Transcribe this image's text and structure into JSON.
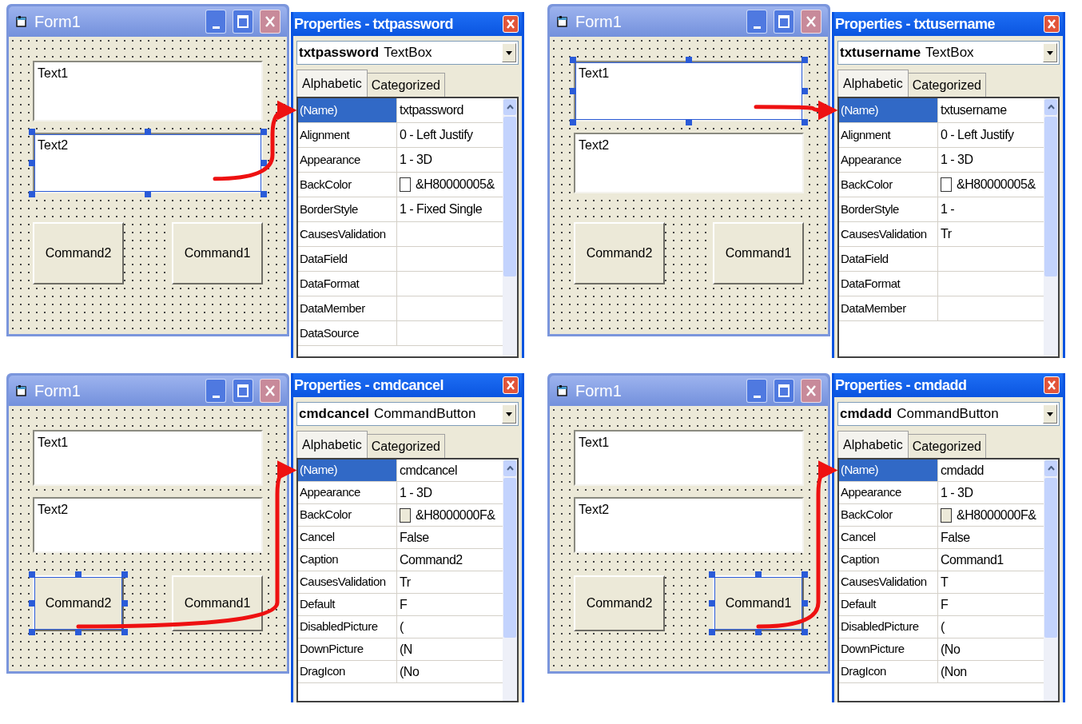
{
  "panels": [
    {
      "form": {
        "title": "Form1",
        "controls": [
          {
            "kind": "textbox",
            "text": "Text1",
            "selected": false
          },
          {
            "kind": "textbox",
            "text": "Text2",
            "selected": true
          },
          {
            "kind": "button",
            "text": "Command2",
            "selected": false
          },
          {
            "kind": "button",
            "text": "Command1",
            "selected": false
          }
        ]
      },
      "properties": {
        "title": "Properties - txtpassword",
        "object_name": "txtpassword",
        "object_type": "TextBox",
        "tabs": [
          {
            "label": "Alphabetic",
            "selected": true
          },
          {
            "label": "Categorized",
            "selected": false
          }
        ],
        "rows": [
          {
            "name": "(Name)",
            "value": "txtpassword",
            "selected": true
          },
          {
            "name": "Alignment",
            "value": "0 - Left Justify",
            "selected": false
          },
          {
            "name": "Appearance",
            "value": "1 - 3D",
            "selected": false
          },
          {
            "name": "BackColor",
            "value": "&H80000005&",
            "color": "#ffffff",
            "selected": false
          },
          {
            "name": "BorderStyle",
            "value": "1 - Fixed Single",
            "selected": false
          },
          {
            "name": "CausesValidation",
            "selected": false
          },
          {
            "name": "DataField",
            "selected": false
          },
          {
            "name": "DataFormat",
            "selected": false
          },
          {
            "name": "DataMember",
            "selected": false
          },
          {
            "name": "DataSource",
            "selected": false
          }
        ]
      }
    },
    {
      "form": {
        "title": "Form1",
        "controls": [
          {
            "kind": "textbox",
            "text": "Text1",
            "selected": true
          },
          {
            "kind": "textbox",
            "text": "Text2",
            "selected": false
          },
          {
            "kind": "button",
            "text": "Command2",
            "selected": false
          },
          {
            "kind": "button",
            "text": "Command1",
            "selected": false
          }
        ]
      },
      "properties": {
        "title": "Properties - txtusername",
        "object_name": "txtusername",
        "object_type": "TextBox",
        "tabs": [
          {
            "label": "Alphabetic",
            "selected": true
          },
          {
            "label": "Categorized",
            "selected": false
          }
        ],
        "rows": [
          {
            "name": "(Name)",
            "value": "txtusername",
            "selected": true
          },
          {
            "name": "Alignment",
            "value": "0 - Left Justify",
            "selected": false
          },
          {
            "name": "Appearance",
            "value": "1 - 3D",
            "selected": false
          },
          {
            "name": "BackColor",
            "value": "&H80000005&",
            "color": "#ffffff",
            "selected": false
          },
          {
            "name": "BorderStyle",
            "value": "1 -",
            "selected": false
          },
          {
            "name": "CausesValidation",
            "value": "Tr",
            "selected": false
          },
          {
            "name": "DataField",
            "selected": false
          },
          {
            "name": "DataFormat",
            "selected": false
          },
          {
            "name": "DataMember",
            "selected": false
          }
        ]
      }
    },
    {
      "form": {
        "title": "Form1",
        "controls": [
          {
            "kind": "textbox",
            "text": "Text1",
            "selected": false
          },
          {
            "kind": "textbox",
            "text": "Text2",
            "selected": false
          },
          {
            "kind": "button",
            "text": "Command2",
            "selected": true
          },
          {
            "kind": "button",
            "text": "Command1",
            "selected": false
          }
        ]
      },
      "properties": {
        "title": "Properties - cmdcancel",
        "object_name": "cmdcancel",
        "object_type": "CommandButton",
        "tabs": [
          {
            "label": "Alphabetic",
            "selected": true
          },
          {
            "label": "Categorized",
            "selected": false
          }
        ],
        "rows": [
          {
            "name": "(Name)",
            "value": "cmdcancel",
            "selected": true
          },
          {
            "name": "Appearance",
            "value": "1 - 3D",
            "selected": false
          },
          {
            "name": "BackColor",
            "value": "&H8000000F&",
            "color": "#ece9d8",
            "selected": false
          },
          {
            "name": "Cancel",
            "value": "False",
            "selected": false
          },
          {
            "name": "Caption",
            "value": "Command2",
            "selected": false
          },
          {
            "name": "CausesValidation",
            "value": "Tr",
            "selected": false
          },
          {
            "name": "Default",
            "value": "F",
            "selected": false
          },
          {
            "name": "DisabledPicture",
            "value": "(",
            "selected": false
          },
          {
            "name": "DownPicture",
            "value": "(N",
            "selected": false
          },
          {
            "name": "DragIcon",
            "value": "(No",
            "selected": false
          }
        ]
      }
    },
    {
      "form": {
        "title": "Form1",
        "controls": [
          {
            "kind": "textbox",
            "text": "Text1",
            "selected": false
          },
          {
            "kind": "textbox",
            "text": "Text2",
            "selected": false
          },
          {
            "kind": "button",
            "text": "Command2",
            "selected": false
          },
          {
            "kind": "button",
            "text": "Command1",
            "selected": true
          }
        ]
      },
      "properties": {
        "title": "Properties - cmdadd",
        "object_name": "cmdadd",
        "object_type": "CommandButton",
        "tabs": [
          {
            "label": "Alphabetic",
            "selected": true
          },
          {
            "label": "Categorized",
            "selected": false
          }
        ],
        "rows": [
          {
            "name": "(Name)",
            "value": "cmdadd",
            "selected": true
          },
          {
            "name": "Appearance",
            "value": "1 - 3D",
            "selected": false
          },
          {
            "name": "BackColor",
            "value": "&H8000000F&",
            "color": "#ece9d8",
            "selected": false
          },
          {
            "name": "Cancel",
            "value": "False",
            "selected": false
          },
          {
            "name": "Caption",
            "value": "Command1",
            "selected": false
          },
          {
            "name": "CausesValidation",
            "value": "T",
            "selected": false
          },
          {
            "name": "Default",
            "value": "F",
            "selected": false
          },
          {
            "name": "DisabledPicture",
            "value": "(",
            "selected": false
          },
          {
            "name": "DownPicture",
            "value": "(No",
            "selected": false
          },
          {
            "name": "DragIcon",
            "value": "(Non",
            "selected": false
          }
        ]
      }
    }
  ]
}
